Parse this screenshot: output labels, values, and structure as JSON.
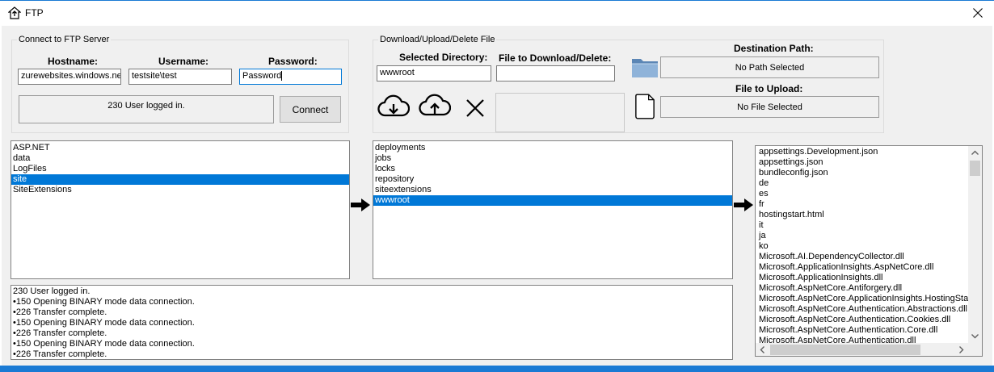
{
  "window": {
    "title": "FTP"
  },
  "connect": {
    "legend": "Connect to FTP Server",
    "hostname_label": "Hostname:",
    "username_label": "Username:",
    "password_label": "Password:",
    "hostname_value": "zurewebsites.windows.net",
    "username_value": "testsite\\test",
    "password_value": "Password",
    "status": "230 User logged in.",
    "connect_button": "Connect"
  },
  "transfer": {
    "legend": "Download/Upload/Delete File",
    "selected_directory_label": "Selected Directory:",
    "selected_directory_value": "wwwroot",
    "file_label": "File to Download/Delete:",
    "file_value": "",
    "destination_label": "Destination Path:",
    "destination_value": "No Path Selected",
    "upload_label": "File to Upload:",
    "upload_value": "No File Selected",
    "icons": [
      "download-icon",
      "upload-icon",
      "delete-icon",
      "folder-icon",
      "file-icon"
    ]
  },
  "list1": [
    "ASP.NET",
    "data",
    "LogFiles",
    "site",
    "SiteExtensions"
  ],
  "list1_selected": "site",
  "list2": [
    "deployments",
    "jobs",
    "locks",
    "repository",
    "siteextensions",
    "wwwroot"
  ],
  "list2_selected": "wwwroot",
  "list3": [
    "appsettings.Development.json",
    "appsettings.json",
    "bundleconfig.json",
    "de",
    "es",
    "fr",
    "hostingstart.html",
    "it",
    "ja",
    "ko",
    "Microsoft.AI.DependencyCollector.dll",
    "Microsoft.ApplicationInsights.AspNetCore.dll",
    "Microsoft.ApplicationInsights.dll",
    "Microsoft.AspNetCore.Antiforgery.dll",
    "Microsoft.AspNetCore.ApplicationInsights.HostingStartup.dll",
    "Microsoft.AspNetCore.Authentication.Abstractions.dll",
    "Microsoft.AspNetCore.Authentication.Cookies.dll",
    "Microsoft.AspNetCore.Authentication.Core.dll",
    "Microsoft.AspNetCore.Authentication.dll"
  ],
  "log": [
    "230 User logged in.",
    "•150 Opening BINARY mode data connection.",
    "•226 Transfer complete.",
    "•150 Opening BINARY mode data connection.",
    "•226 Transfer complete.",
    "•150 Opening BINARY mode data connection.",
    "•226 Transfer complete."
  ],
  "colors": {
    "accent": "#0078d7",
    "titlebar_border": "#1a7ad4"
  }
}
